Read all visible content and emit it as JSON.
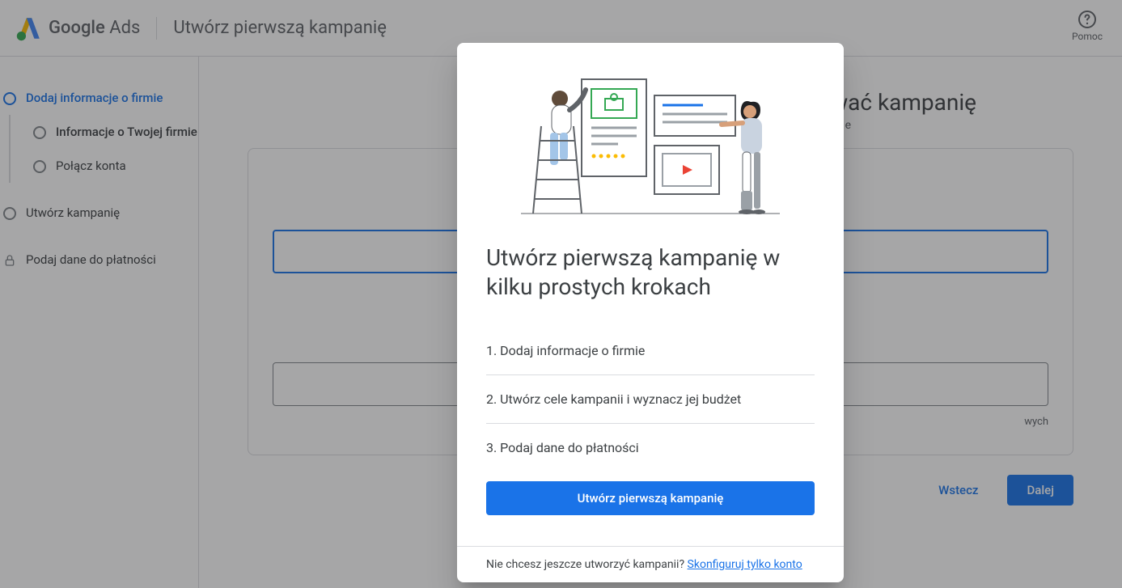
{
  "header": {
    "logo_text_1": "Google",
    "logo_text_2": "Ads",
    "page_title": "Utwórz pierwszą kampanię",
    "help_label": "Pomoc"
  },
  "sidebar": {
    "step1": "Dodaj informacje o firmie",
    "substep1": "Informacje o Twojej firmie",
    "substep2": "Połącz konta",
    "step2": "Utwórz kampanię",
    "step3": "Podaj dane do płatności"
  },
  "content": {
    "title_suffix": "wać kampanię",
    "hint_suffix": "wych",
    "back": "Wstecz",
    "next": "Dalej"
  },
  "modal": {
    "title": "Utwórz pierwszą kampanię w kilku prostych krokach",
    "item1": "1. Dodaj informacje o firmie",
    "item2": "2. Utwórz cele kampanii i wyznacz jej budżet",
    "item3": "3. Podaj dane do płatności",
    "cta": "Utwórz pierwszą kampanię",
    "footer_text": "Nie chcesz jeszcze utworzyć kampanii? ",
    "footer_link": "Skonfiguruj tylko konto"
  }
}
